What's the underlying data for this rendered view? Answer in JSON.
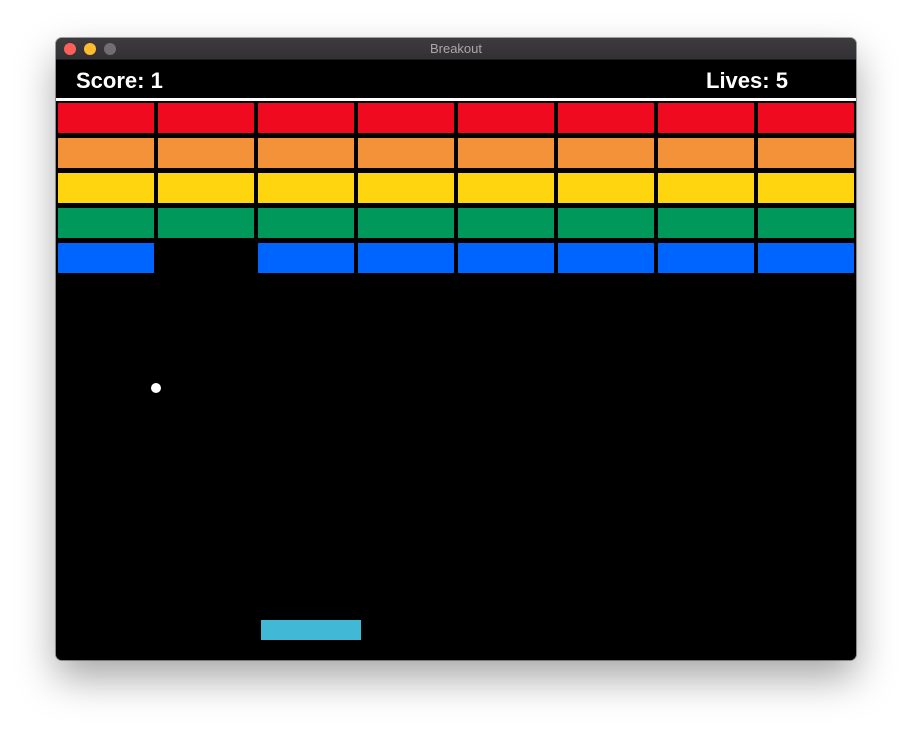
{
  "window": {
    "title": "Breakout"
  },
  "hud": {
    "score": "Score: 1",
    "lives": "Lives: 5"
  },
  "bricks": {
    "rows": [
      {
        "color": "red",
        "hex": "#ef0a20",
        "present": [
          1,
          1,
          1,
          1,
          1,
          1,
          1,
          1
        ]
      },
      {
        "color": "orange",
        "hex": "#f39238",
        "present": [
          1,
          1,
          1,
          1,
          1,
          1,
          1,
          1
        ]
      },
      {
        "color": "yellow",
        "hex": "#ffd510",
        "present": [
          1,
          1,
          1,
          1,
          1,
          1,
          1,
          1
        ]
      },
      {
        "color": "green",
        "hex": "#00995b",
        "present": [
          1,
          1,
          1,
          1,
          1,
          1,
          1,
          1
        ]
      },
      {
        "color": "blue",
        "hex": "#0064ff",
        "present": [
          1,
          0,
          1,
          1,
          1,
          1,
          1,
          1
        ]
      }
    ]
  },
  "ball": {
    "color": "#ffffff"
  },
  "paddle": {
    "color": "#42b8d7"
  },
  "colors": {
    "close_button": "#fe5f58",
    "minimize_button": "#febc2e",
    "zoom_button": "#706e72"
  }
}
